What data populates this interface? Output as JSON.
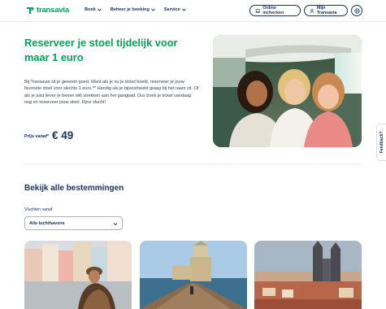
{
  "brand": {
    "name": "transavia",
    "color": "#00a35a",
    "navy": "#1b3160"
  },
  "nav": {
    "items": [
      {
        "label": "Boek",
        "icon": "chevron-down-icon"
      },
      {
        "label": "Beheer je boeking",
        "icon": "chevron-down-icon"
      },
      {
        "label": "Service",
        "icon": "chevron-down-icon"
      }
    ],
    "checkin_label": "Online inchecken",
    "my_transavia_label": "Mijn Transavia",
    "language_icon": "globe-icon"
  },
  "hero": {
    "title": "Reserveer je stoel tijdelijk voor maar 1 euro",
    "body": "Bij Transavia zit je gewoon goed. Want als je nu je ticket boekt, reserveer je jouw favoriete stoel voor slechts 1 euro.** Handig als je bijvoorbeeld graag bij het raam zit. Of als je juist liever je benen wilt strekken aan het gangpad. Dus boek je ticket vandaag nog en reserveer jouw stoel. Fijne vlucht!",
    "price_label": "Prijs vanaf*",
    "price_value": "€ 49"
  },
  "feedback_label": "Feedback?",
  "destinations": {
    "title": "Bekijk alle bestemmingen",
    "filter_label": "Vluchten vanaf",
    "filter_value": "Alle luchthavens"
  }
}
